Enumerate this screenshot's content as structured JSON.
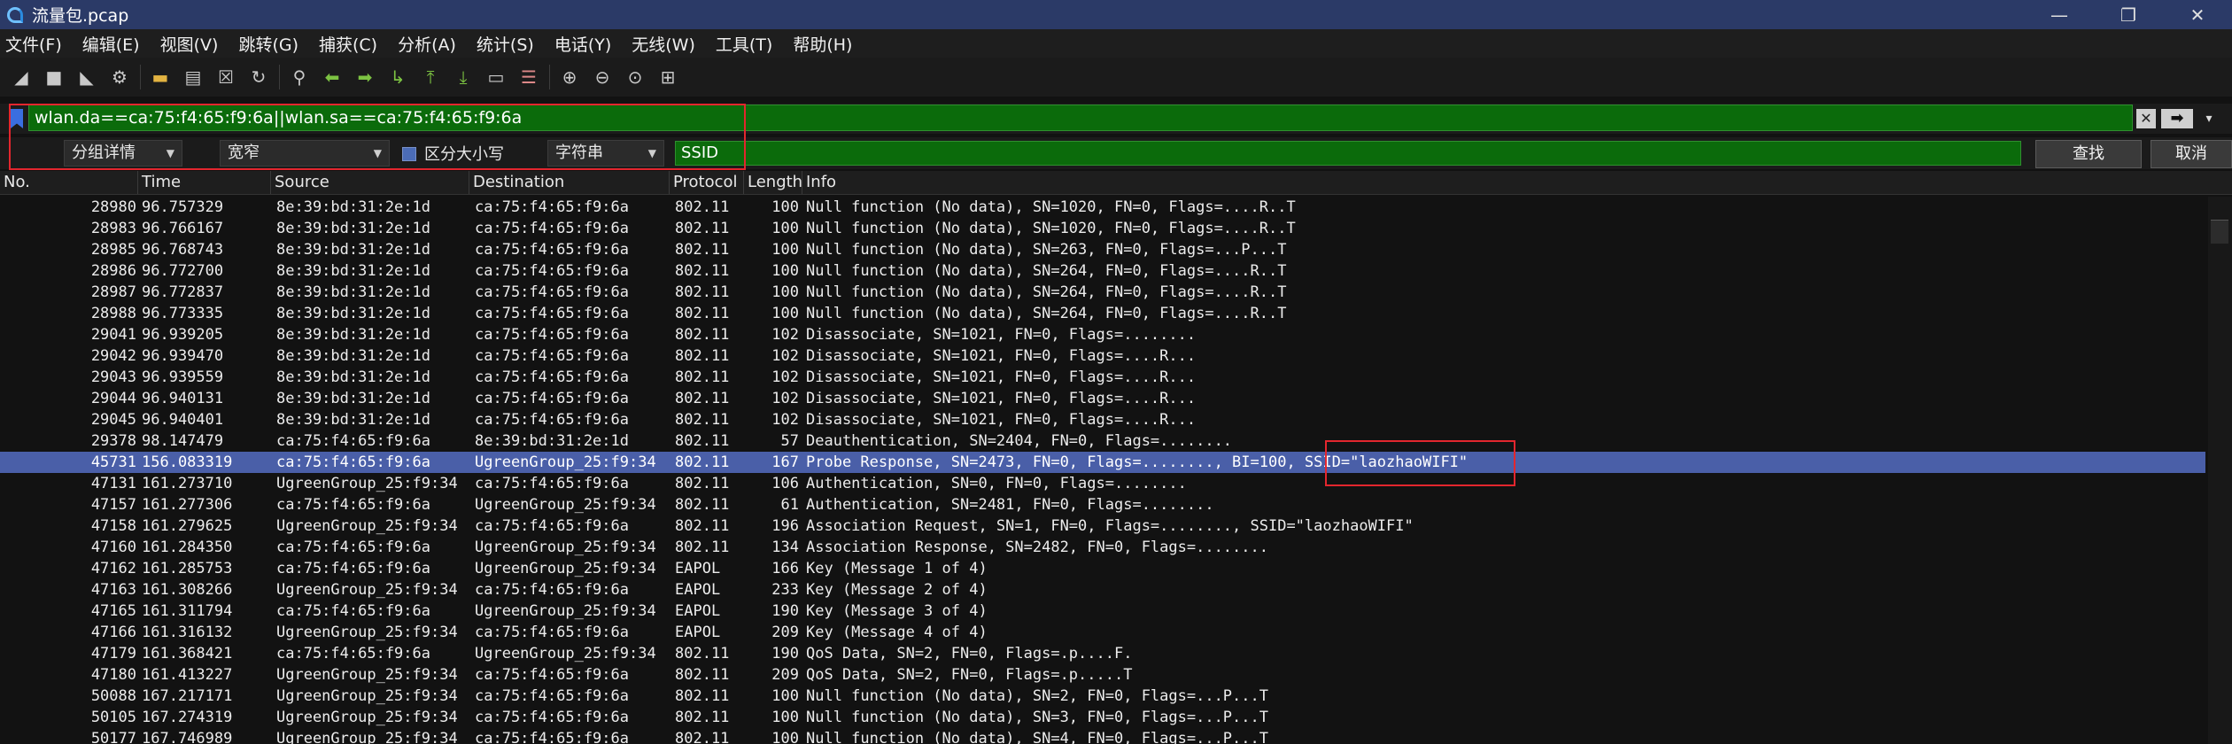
{
  "window": {
    "title": "流量包.pcap",
    "controls": {
      "close": "✕",
      "restore": "❐",
      "minimize": "—"
    }
  },
  "menu": [
    "文件(F)",
    "编辑(E)",
    "视图(V)",
    "跳转(G)",
    "捕获(C)",
    "分析(A)",
    "统计(S)",
    "电话(Y)",
    "无线(W)",
    "工具(T)",
    "帮助(H)"
  ],
  "toolbar_icons": [
    "shark-fin-start-icon",
    "stop-square-icon",
    "restart-fin-icon",
    "options-gear-icon",
    "open-folder-icon",
    "file-icon",
    "close-file-icon",
    "reload-icon",
    "find-magnifier-icon",
    "go-back-arrow-icon",
    "go-forward-arrow-icon",
    "go-to-packet-icon",
    "first-packet-icon",
    "last-packet-icon",
    "autoscroll-icon",
    "colorize-icon",
    "zoom-in-icon",
    "zoom-out-icon",
    "normal-size-icon",
    "resize-columns-icon"
  ],
  "filter": {
    "value": "wlan.da==ca:75:f4:65:f9:6a||wlan.sa==ca:75:f4:65:f9:6a",
    "clear_glyph": "✕",
    "apply_glyph": "➡",
    "dropdown_glyph": "▾"
  },
  "find": {
    "search_in": "分组详情",
    "char_width": "宽窄",
    "case_label": "区分大小写",
    "search_type": "字符串",
    "search_value": "SSID",
    "find_label": "查找",
    "cancel_label": "取消"
  },
  "columns": [
    "No.",
    "Time",
    "Source",
    "Destination",
    "Protocol",
    "Length",
    "Info"
  ],
  "packets": [
    {
      "no": "28980",
      "time": "96.757329",
      "src": "8e:39:bd:31:2e:1d",
      "dst": "ca:75:f4:65:f9:6a",
      "proto": "802.11",
      "len": "100",
      "info": "Null function (No data), SN=1020, FN=0, Flags=....R..T"
    },
    {
      "no": "28983",
      "time": "96.766167",
      "src": "8e:39:bd:31:2e:1d",
      "dst": "ca:75:f4:65:f9:6a",
      "proto": "802.11",
      "len": "100",
      "info": "Null function (No data), SN=1020, FN=0, Flags=....R..T"
    },
    {
      "no": "28985",
      "time": "96.768743",
      "src": "8e:39:bd:31:2e:1d",
      "dst": "ca:75:f4:65:f9:6a",
      "proto": "802.11",
      "len": "100",
      "info": "Null function (No data), SN=263, FN=0, Flags=...P...T"
    },
    {
      "no": "28986",
      "time": "96.772700",
      "src": "8e:39:bd:31:2e:1d",
      "dst": "ca:75:f4:65:f9:6a",
      "proto": "802.11",
      "len": "100",
      "info": "Null function (No data), SN=264, FN=0, Flags=....R..T"
    },
    {
      "no": "28987",
      "time": "96.772837",
      "src": "8e:39:bd:31:2e:1d",
      "dst": "ca:75:f4:65:f9:6a",
      "proto": "802.11",
      "len": "100",
      "info": "Null function (No data), SN=264, FN=0, Flags=....R..T"
    },
    {
      "no": "28988",
      "time": "96.773335",
      "src": "8e:39:bd:31:2e:1d",
      "dst": "ca:75:f4:65:f9:6a",
      "proto": "802.11",
      "len": "100",
      "info": "Null function (No data), SN=264, FN=0, Flags=....R..T"
    },
    {
      "no": "29041",
      "time": "96.939205",
      "src": "8e:39:bd:31:2e:1d",
      "dst": "ca:75:f4:65:f9:6a",
      "proto": "802.11",
      "len": "102",
      "info": "Disassociate, SN=1021, FN=0, Flags=........"
    },
    {
      "no": "29042",
      "time": "96.939470",
      "src": "8e:39:bd:31:2e:1d",
      "dst": "ca:75:f4:65:f9:6a",
      "proto": "802.11",
      "len": "102",
      "info": "Disassociate, SN=1021, FN=0, Flags=....R..."
    },
    {
      "no": "29043",
      "time": "96.939559",
      "src": "8e:39:bd:31:2e:1d",
      "dst": "ca:75:f4:65:f9:6a",
      "proto": "802.11",
      "len": "102",
      "info": "Disassociate, SN=1021, FN=0, Flags=....R..."
    },
    {
      "no": "29044",
      "time": "96.940131",
      "src": "8e:39:bd:31:2e:1d",
      "dst": "ca:75:f4:65:f9:6a",
      "proto": "802.11",
      "len": "102",
      "info": "Disassociate, SN=1021, FN=0, Flags=....R..."
    },
    {
      "no": "29045",
      "time": "96.940401",
      "src": "8e:39:bd:31:2e:1d",
      "dst": "ca:75:f4:65:f9:6a",
      "proto": "802.11",
      "len": "102",
      "info": "Disassociate, SN=1021, FN=0, Flags=....R..."
    },
    {
      "no": "29378",
      "time": "98.147479",
      "src": "ca:75:f4:65:f9:6a",
      "dst": "8e:39:bd:31:2e:1d",
      "proto": "802.11",
      "len": "57",
      "info": "Deauthentication, SN=2404, FN=0, Flags=........"
    },
    {
      "no": "45731",
      "time": "156.083319",
      "src": "ca:75:f4:65:f9:6a",
      "dst": "UgreenGroup_25:f9:34",
      "proto": "802.11",
      "len": "167",
      "info": "Probe Response, SN=2473, FN=0, Flags=........, BI=100, SSID=\"laozhaoWIFI\"",
      "selected": true
    },
    {
      "no": "47131",
      "time": "161.273710",
      "src": "UgreenGroup_25:f9:34",
      "dst": "ca:75:f4:65:f9:6a",
      "proto": "802.11",
      "len": "106",
      "info": "Authentication, SN=0, FN=0, Flags=........"
    },
    {
      "no": "47157",
      "time": "161.277306",
      "src": "ca:75:f4:65:f9:6a",
      "dst": "UgreenGroup_25:f9:34",
      "proto": "802.11",
      "len": "61",
      "info": "Authentication, SN=2481, FN=0, Flags=........"
    },
    {
      "no": "47158",
      "time": "161.279625",
      "src": "UgreenGroup_25:f9:34",
      "dst": "ca:75:f4:65:f9:6a",
      "proto": "802.11",
      "len": "196",
      "info": "Association Request, SN=1, FN=0, Flags=........, SSID=\"laozhaoWIFI\""
    },
    {
      "no": "47160",
      "time": "161.284350",
      "src": "ca:75:f4:65:f9:6a",
      "dst": "UgreenGroup_25:f9:34",
      "proto": "802.11",
      "len": "134",
      "info": "Association Response, SN=2482, FN=0, Flags=........"
    },
    {
      "no": "47162",
      "time": "161.285753",
      "src": "ca:75:f4:65:f9:6a",
      "dst": "UgreenGroup_25:f9:34",
      "proto": "EAPOL",
      "len": "166",
      "info": "Key (Message 1 of 4)"
    },
    {
      "no": "47163",
      "time": "161.308266",
      "src": "UgreenGroup_25:f9:34",
      "dst": "ca:75:f4:65:f9:6a",
      "proto": "EAPOL",
      "len": "233",
      "info": "Key (Message 2 of 4)"
    },
    {
      "no": "47165",
      "time": "161.311794",
      "src": "ca:75:f4:65:f9:6a",
      "dst": "UgreenGroup_25:f9:34",
      "proto": "EAPOL",
      "len": "190",
      "info": "Key (Message 3 of 4)"
    },
    {
      "no": "47166",
      "time": "161.316132",
      "src": "UgreenGroup_25:f9:34",
      "dst": "ca:75:f4:65:f9:6a",
      "proto": "EAPOL",
      "len": "209",
      "info": "Key (Message 4 of 4)"
    },
    {
      "no": "47179",
      "time": "161.368421",
      "src": "ca:75:f4:65:f9:6a",
      "dst": "UgreenGroup_25:f9:34",
      "proto": "802.11",
      "len": "190",
      "info": "QoS Data, SN=2, FN=0, Flags=.p....F."
    },
    {
      "no": "47180",
      "time": "161.413227",
      "src": "UgreenGroup_25:f9:34",
      "dst": "ca:75:f4:65:f9:6a",
      "proto": "802.11",
      "len": "209",
      "info": "QoS Data, SN=2, FN=0, Flags=.p.....T"
    },
    {
      "no": "50088",
      "time": "167.217171",
      "src": "UgreenGroup_25:f9:34",
      "dst": "ca:75:f4:65:f9:6a",
      "proto": "802.11",
      "len": "100",
      "info": "Null function (No data), SN=2, FN=0, Flags=...P...T"
    },
    {
      "no": "50105",
      "time": "167.274319",
      "src": "UgreenGroup_25:f9:34",
      "dst": "ca:75:f4:65:f9:6a",
      "proto": "802.11",
      "len": "100",
      "info": "Null function (No data), SN=3, FN=0, Flags=...P...T"
    },
    {
      "no": "50177",
      "time": "167.746989",
      "src": "UgreenGroup_25:f9:34",
      "dst": "ca:75:f4:65:f9:6a",
      "proto": "802.11",
      "len": "100",
      "info": "Null function (No data), SN=4, FN=0, Flags=...P...T"
    }
  ],
  "colors": {
    "selected_row": "#4a5fa8",
    "filter_valid": "#0b6b0b",
    "highlight_box": "#e3262e",
    "titlebar": "#2b3a67"
  }
}
